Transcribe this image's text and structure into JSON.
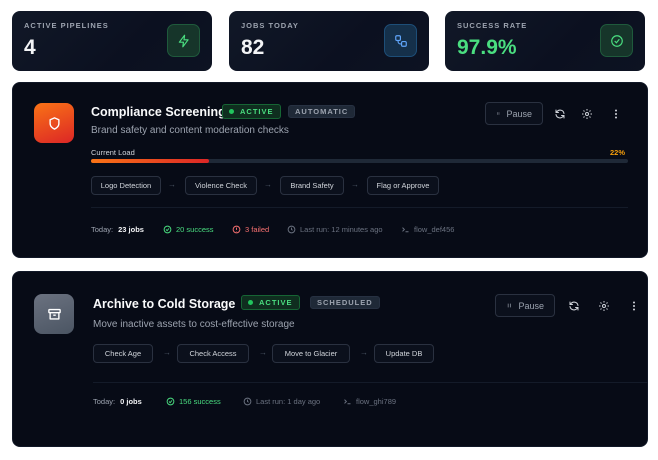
{
  "stats": [
    {
      "label": "ACTIVE PIPELINES",
      "value": "4",
      "icon": "zap-icon"
    },
    {
      "label": "JOBS TODAY",
      "value": "82",
      "icon": "workflow-icon"
    },
    {
      "label": "SUCCESS RATE",
      "value": "97.9%",
      "icon": "check-circle-icon"
    }
  ],
  "pipelines": [
    {
      "title": "Compliance Screening",
      "status": "ACTIVE",
      "mode": "AUTOMATIC",
      "description": "Brand safety and content moderation checks",
      "pause_label": "Pause",
      "load_label": "Current Load",
      "load_value": "22%",
      "load_fraction": 0.22,
      "steps": [
        "Logo Detection",
        "Violence Check",
        "Brand Safety",
        "Flag or Approve"
      ],
      "today_label": "Today:",
      "jobs": "23 jobs",
      "success": "20 success",
      "failed": "3 failed",
      "last_run": "Last run: 12 minutes ago",
      "flow_id": "flow_def456",
      "icon": "shield-icon"
    },
    {
      "title": "Archive to Cold Storage",
      "status": "ACTIVE",
      "mode": "SCHEDULED",
      "description": "Move inactive assets to cost-effective storage",
      "pause_label": "Pause",
      "steps": [
        "Check Age",
        "Check Access",
        "Move to Glacier",
        "Update DB"
      ],
      "today_label": "Today:",
      "jobs": "0 jobs",
      "success": "156 success",
      "last_run": "Last run: 1 day ago",
      "flow_id": "flow_ghi789",
      "icon": "archive-icon"
    }
  ],
  "colors": {
    "accent_green": "#4ade80",
    "accent_orange": "#f97316",
    "danger": "#f87171"
  }
}
